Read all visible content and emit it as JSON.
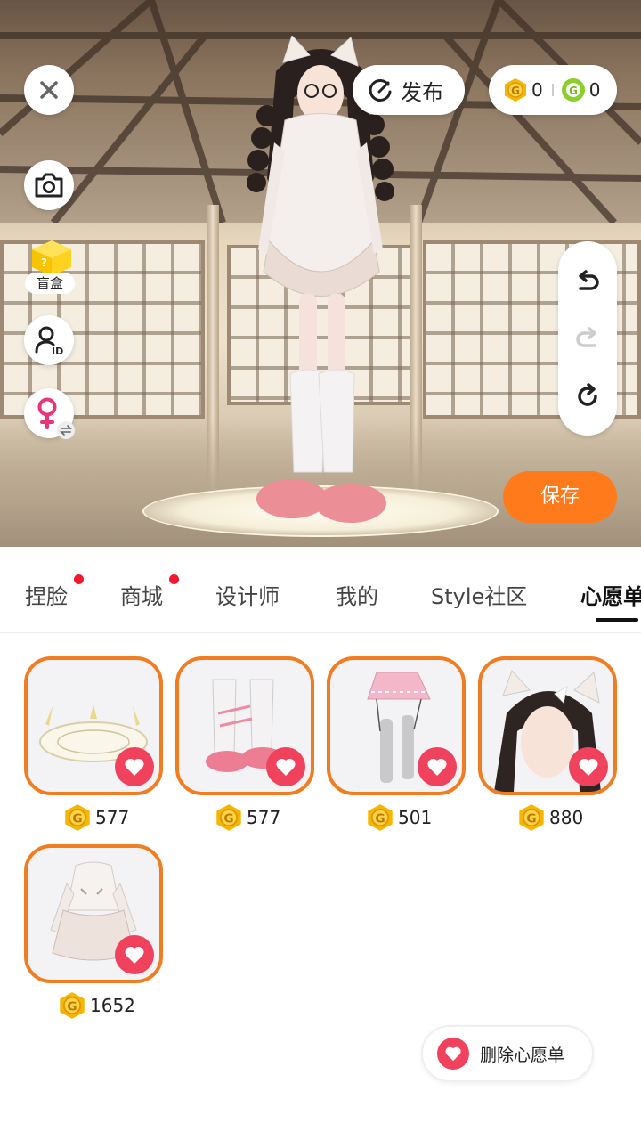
{
  "toolbar": {
    "close_icon": "close-icon",
    "publish_label": "发布",
    "gold_coins": "0",
    "green_coins": "0",
    "blind_box_label": "盲盒",
    "save_label": "保存"
  },
  "tabs": [
    {
      "label": "捏脸",
      "has_dot": true
    },
    {
      "label": "商城",
      "has_dot": true
    },
    {
      "label": "设计师",
      "has_dot": false
    },
    {
      "label": "我的",
      "has_dot": false
    },
    {
      "label": "Style社区",
      "has_dot": false
    },
    {
      "label": "心愿单",
      "has_dot": false,
      "active": true
    }
  ],
  "wishlist": [
    {
      "name": "magic-circle",
      "price": "577"
    },
    {
      "name": "leg-warmers-shoes",
      "price": "577"
    },
    {
      "name": "pink-skirt-stockings",
      "price": "501"
    },
    {
      "name": "cat-ear-hair",
      "price": "880"
    },
    {
      "name": "white-dress",
      "price": "1652"
    }
  ],
  "delete_wishlist_label": "删除心愿单",
  "colors": {
    "accent": "#ff7a1a",
    "card_border": "#f07d22",
    "heart": "#f0415d",
    "coin_gold": "#f7b500",
    "coin_green": "#8bcf2a"
  }
}
